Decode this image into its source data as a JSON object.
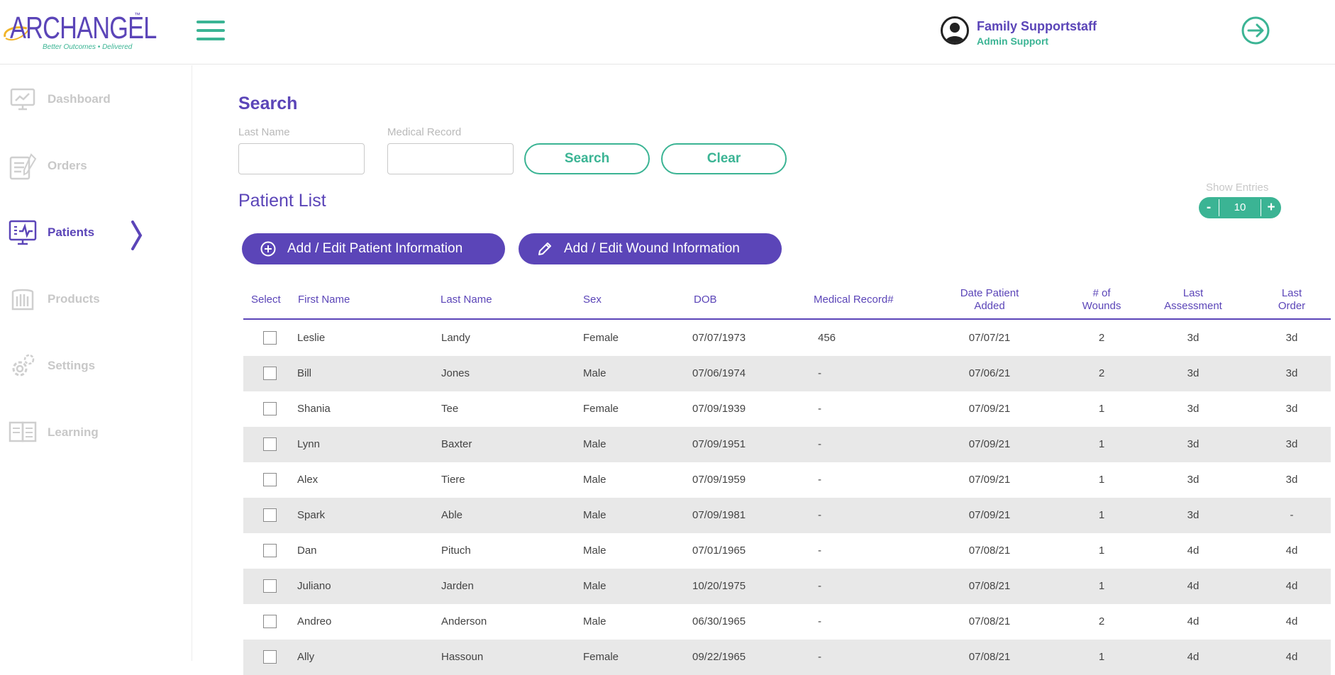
{
  "brand": {
    "logo_text": "ARCHANGEL",
    "trademark": "™",
    "tagline": "Better Outcomes • Delivered",
    "accent_purple": "#5b45b8",
    "accent_green": "#3bb494"
  },
  "header": {
    "user_name": "Family Supportstaff",
    "user_role": "Admin Support"
  },
  "sidebar": {
    "items": [
      {
        "label": "Dashboard",
        "icon": "dashboard-icon",
        "active": false
      },
      {
        "label": "Orders",
        "icon": "orders-icon",
        "active": false
      },
      {
        "label": "Patients",
        "icon": "patients-monitor-icon",
        "active": true
      },
      {
        "label": "Products",
        "icon": "products-icon",
        "active": false
      },
      {
        "label": "Settings",
        "icon": "gear-icon",
        "active": false
      },
      {
        "label": "Learning",
        "icon": "learning-icon",
        "active": false
      }
    ]
  },
  "search": {
    "title": "Search",
    "last_name_label": "Last Name",
    "last_name_value": "",
    "medical_record_label": "Medical Record",
    "medical_record_value": "",
    "search_button": "Search",
    "clear_button": "Clear"
  },
  "patient_list": {
    "title": "Patient List",
    "show_entries_label": "Show Entries",
    "entries_value": "10",
    "minus_label": "-",
    "plus_label": "+",
    "add_patient_button": "Add / Edit Patient Information",
    "add_wound_button": "Add / Edit Wound Information",
    "columns": {
      "select": "Select",
      "first_name": "First Name",
      "last_name": "Last Name",
      "sex": "Sex",
      "dob": "DOB",
      "medical_record": "Medical Record#",
      "date_added_1": "Date Patient",
      "date_added_2": "Added",
      "wounds_1": "# of",
      "wounds_2": "Wounds",
      "last_assessment_1": "Last",
      "last_assessment_2": "Assessment",
      "last_order_1": "Last",
      "last_order_2": "Order"
    },
    "rows": [
      {
        "first": "Leslie",
        "last": "Landy",
        "sex": "Female",
        "dob": "07/07/1973",
        "mrn": "456",
        "added": "07/07/21",
        "wounds": "2",
        "assessment": "3d",
        "order": "3d"
      },
      {
        "first": "Bill",
        "last": "Jones",
        "sex": "Male",
        "dob": "07/06/1974",
        "mrn": "-",
        "added": "07/06/21",
        "wounds": "2",
        "assessment": "3d",
        "order": "3d"
      },
      {
        "first": "Shania",
        "last": "Tee",
        "sex": "Female",
        "dob": "07/09/1939",
        "mrn": "-",
        "added": "07/09/21",
        "wounds": "1",
        "assessment": "3d",
        "order": "3d"
      },
      {
        "first": "Lynn",
        "last": "Baxter",
        "sex": "Male",
        "dob": "07/09/1951",
        "mrn": "-",
        "added": "07/09/21",
        "wounds": "1",
        "assessment": "3d",
        "order": "3d"
      },
      {
        "first": "Alex",
        "last": "Tiere",
        "sex": "Male",
        "dob": "07/09/1959",
        "mrn": "-",
        "added": "07/09/21",
        "wounds": "1",
        "assessment": "3d",
        "order": "3d"
      },
      {
        "first": "Spark",
        "last": "Able",
        "sex": "Male",
        "dob": "07/09/1981",
        "mrn": "-",
        "added": "07/09/21",
        "wounds": "1",
        "assessment": "3d",
        "order": "-"
      },
      {
        "first": "Dan",
        "last": "Pituch",
        "sex": "Male",
        "dob": "07/01/1965",
        "mrn": "-",
        "added": "07/08/21",
        "wounds": "1",
        "assessment": "4d",
        "order": "4d"
      },
      {
        "first": "Juliano",
        "last": "Jarden",
        "sex": "Male",
        "dob": "10/20/1975",
        "mrn": "-",
        "added": "07/08/21",
        "wounds": "1",
        "assessment": "4d",
        "order": "4d"
      },
      {
        "first": "Andreo",
        "last": "Anderson",
        "sex": "Male",
        "dob": "06/30/1965",
        "mrn": "-",
        "added": "07/08/21",
        "wounds": "2",
        "assessment": "4d",
        "order": "4d"
      },
      {
        "first": "Ally",
        "last": "Hassoun",
        "sex": "Female",
        "dob": "09/22/1965",
        "mrn": "-",
        "added": "07/08/21",
        "wounds": "1",
        "assessment": "4d",
        "order": "4d"
      }
    ]
  }
}
